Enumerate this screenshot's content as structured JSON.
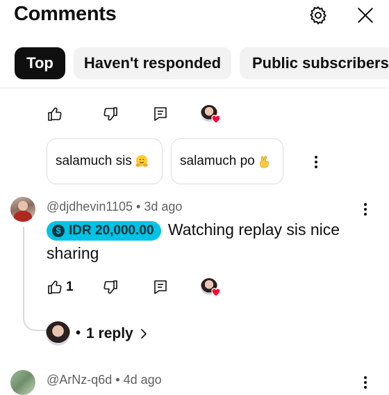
{
  "header": {
    "title": "Comments",
    "settings_icon": "gear-icon",
    "close_icon": "close-icon"
  },
  "filters": [
    {
      "label": "Top",
      "active": true
    },
    {
      "label": "Haven't responded",
      "active": false
    },
    {
      "label": "Public subscribers",
      "active": false
    }
  ],
  "suggested_replies": [
    {
      "text": "salamuch sis",
      "emoji": "hugging-face"
    },
    {
      "text": "salamuch po",
      "emoji": "crossed-fingers"
    }
  ],
  "comments": [
    {
      "author": "@djdhevin1105",
      "time": "3d ago",
      "tip": "IDR 20,000.00",
      "text": "Watching replay sis nice sharing",
      "likes": "1",
      "replies_label": "1 reply"
    },
    {
      "author": "@ArNz-q6d",
      "time": "4d ago"
    }
  ],
  "colors": {
    "accent_tip": "#00c3e6",
    "heart": "#ff0033",
    "chip_active_bg": "#0f0f0f",
    "chip_inactive_bg": "#f2f2f2"
  }
}
